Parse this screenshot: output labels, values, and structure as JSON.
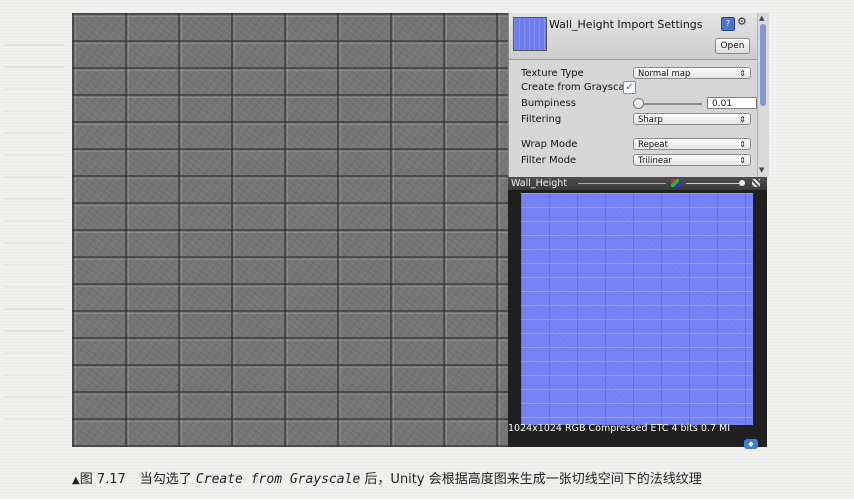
{
  "inspector": {
    "title": "Wall_Height Import Settings",
    "open_label": "Open",
    "help_glyph": "?",
    "gear_glyph": "⚙",
    "rows": {
      "texture_type": {
        "label": "Texture Type",
        "value": "Normal map"
      },
      "create_from_grayscale": {
        "label": "Create from Grayscale",
        "checked": true,
        "check_glyph": "✓"
      },
      "bumpiness": {
        "label": "Bumpiness",
        "value": "0.01"
      },
      "filtering": {
        "label": "Filtering",
        "value": "Sharp"
      },
      "wrap_mode": {
        "label": "Wrap Mode",
        "value": "Repeat"
      },
      "filter_mode": {
        "label": "Filter Mode",
        "value": "Trilinear"
      }
    },
    "dropdown_arrow": "⇕"
  },
  "preview": {
    "title": "Wall_Height",
    "info": "1024x1024  RGB Compressed ETC 4 bits   0.7 MI"
  },
  "caption": {
    "marker": "▲",
    "figure": "图 7.17",
    "text_before": "当勾选了 ",
    "italic": "Create from Grayscale",
    "text_after": " 后，Unity 会根据高度图来生成一张切线空间下的法线纹理"
  },
  "icons": {
    "help": "help-icon",
    "gear": "gear-icon",
    "rgb": "rgb-channels-icon",
    "alpha": "alpha-icon",
    "tag": "tag-icon"
  },
  "colors": {
    "normal_map": "#7480f4",
    "panel": "#d6d6d6",
    "checkbox_accent": "#2a62c8"
  }
}
